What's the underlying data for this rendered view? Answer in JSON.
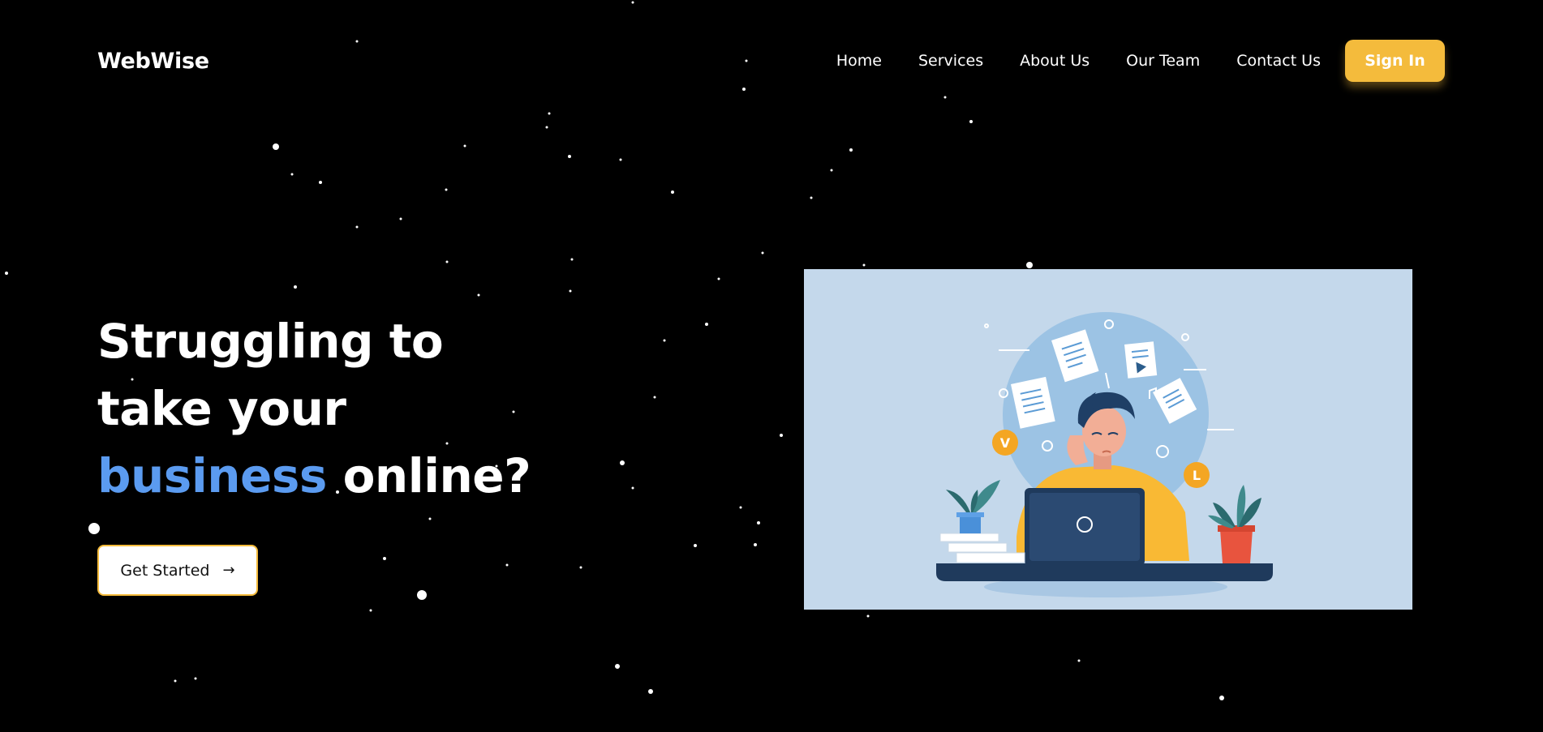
{
  "header": {
    "logo": "WebWise",
    "nav": [
      "Home",
      "Services",
      "About Us",
      "Our Team",
      "Contact Us"
    ],
    "signin_label": "Sign In"
  },
  "hero": {
    "line1": "Struggling to",
    "line2": "take your",
    "line3_accent": "business",
    "line3_rest": " online?",
    "cta_label": "Get Started"
  },
  "illustration": {
    "badge_v": "V",
    "badge_l": "L"
  },
  "colors": {
    "background": "#000000",
    "accent_blue": "#5b9bf0",
    "accent_yellow": "#f4bb3c",
    "illustration_bg": "#c4d8eb"
  },
  "icons": [
    "arrow-right-icon"
  ]
}
